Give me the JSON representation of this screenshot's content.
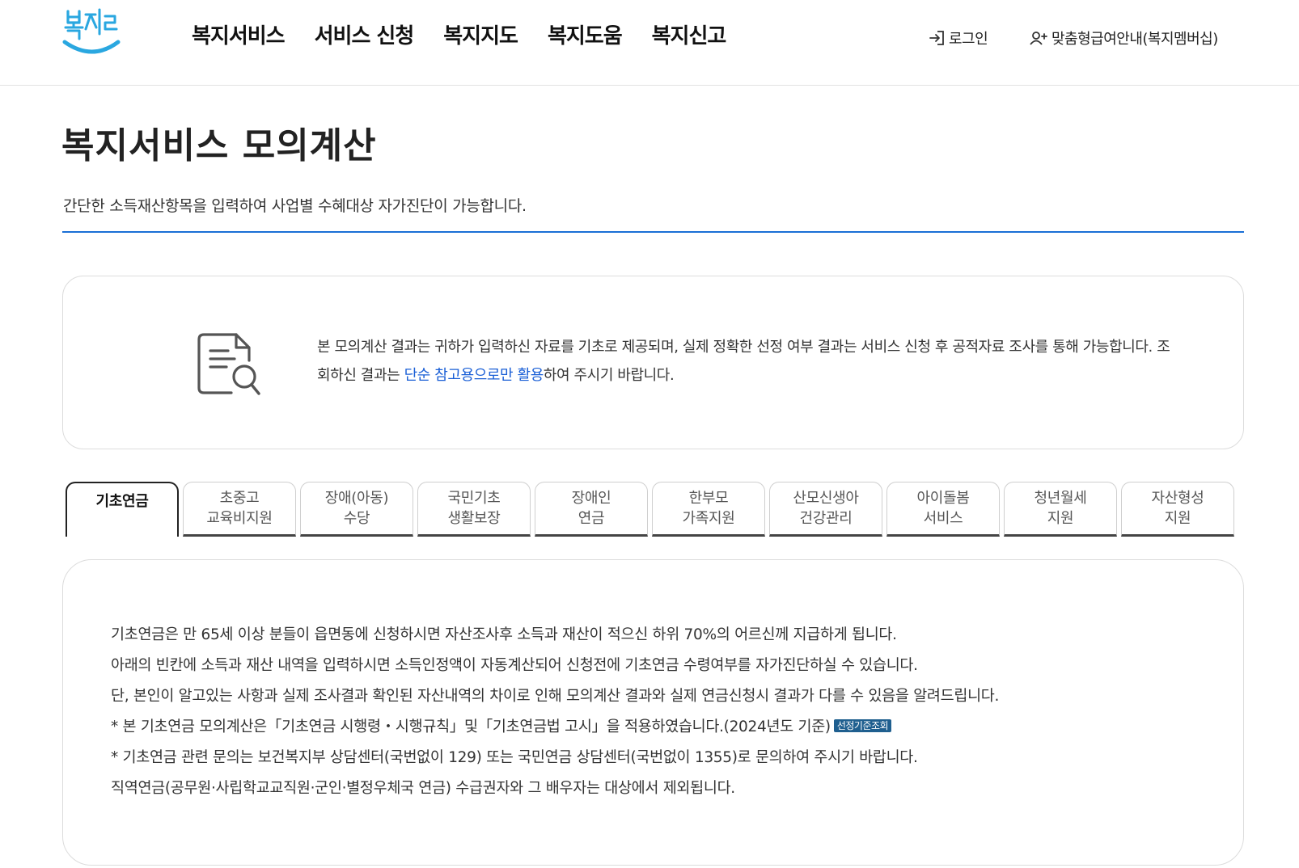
{
  "header": {
    "logo_text": "복지로",
    "nav": [
      "복지서비스",
      "서비스 신청",
      "복지지도",
      "복지도움",
      "복지신고"
    ],
    "login_label": "로그인",
    "membership_label": "맞춤형급여안내(복지멤버십)",
    "login_icon": "login-arrow-icon",
    "membership_icon": "user-add-icon"
  },
  "page": {
    "title": "복지서비스 모의계산",
    "description": "간단한 소득재산항목을 입력하여 사업별 수혜대상 자가진단이 가능합니다."
  },
  "notice": {
    "icon": "document-search-icon",
    "text_before": "본 모의계산 결과는 귀하가 입력하신 자료를 기초로 제공되며, 실제 정확한 선정 여부 결과는 서비스 신청 후 공적자료 조사를 통해 가능합니다. 조회하신 결과는 ",
    "text_highlight": "단순 참고용으로만 활용",
    "text_after": "하여 주시기 바랍니다."
  },
  "tabs": [
    {
      "line1": "기초연금",
      "line2": "",
      "active": true
    },
    {
      "line1": "초중고",
      "line2": "교육비지원",
      "active": false
    },
    {
      "line1": "장애(아동)",
      "line2": "수당",
      "active": false
    },
    {
      "line1": "국민기초",
      "line2": "생활보장",
      "active": false
    },
    {
      "line1": "장애인",
      "line2": "연금",
      "active": false
    },
    {
      "line1": "한부모",
      "line2": "가족지원",
      "active": false
    },
    {
      "line1": "산모신생아",
      "line2": "건강관리",
      "active": false
    },
    {
      "line1": "아이돌봄",
      "line2": "서비스",
      "active": false
    },
    {
      "line1": "청년월세",
      "line2": "지원",
      "active": false
    },
    {
      "line1": "자산형성",
      "line2": "지원",
      "active": false
    }
  ],
  "info": {
    "line1": "기초연금은 만 65세 이상 분들이 읍면동에 신청하시면 자산조사후 소득과 재산이 적으신 하위 70%의 어르신께 지급하게 됩니다.",
    "line2": "아래의 빈칸에 소득과 재산 내역을 입력하시면 소득인정액이 자동계산되어 신청전에 기초연금 수령여부를 자가진단하실 수 있습니다.",
    "line3": "단, 본인이 알고있는 사항과 실제 조사결과 확인된 자산내역의 차이로 인해 모의계산 결과와 실제 연금신청시 결과가 다를 수 있음을 알려드립니다.",
    "line4": "* 본 기초연금 모의계산은「기초연금 시행령・시행규칙」및「기초연금법 고시」을 적용하였습니다.(2024년도 기준)",
    "criteria_button": "선정기준조회",
    "line5": "* 기초연금 관련 문의는 보건복지부 상담센터(국번없이 129) 또는 국민연금 상담센터(국번없이 1355)로 문의하여 주시기 바랍니다.",
    "line6": "직역연금(공무원·사립학교교직원·군인·별정우체국 연금) 수급권자와 그 배우자는 대상에서 제외됩니다."
  },
  "colors": {
    "accent_blue": "#1a6fd6",
    "highlight_blue": "#1a5fd6",
    "logo_blue": "#2aa7e0",
    "criteria_button_bg": "#1f5f8f"
  }
}
